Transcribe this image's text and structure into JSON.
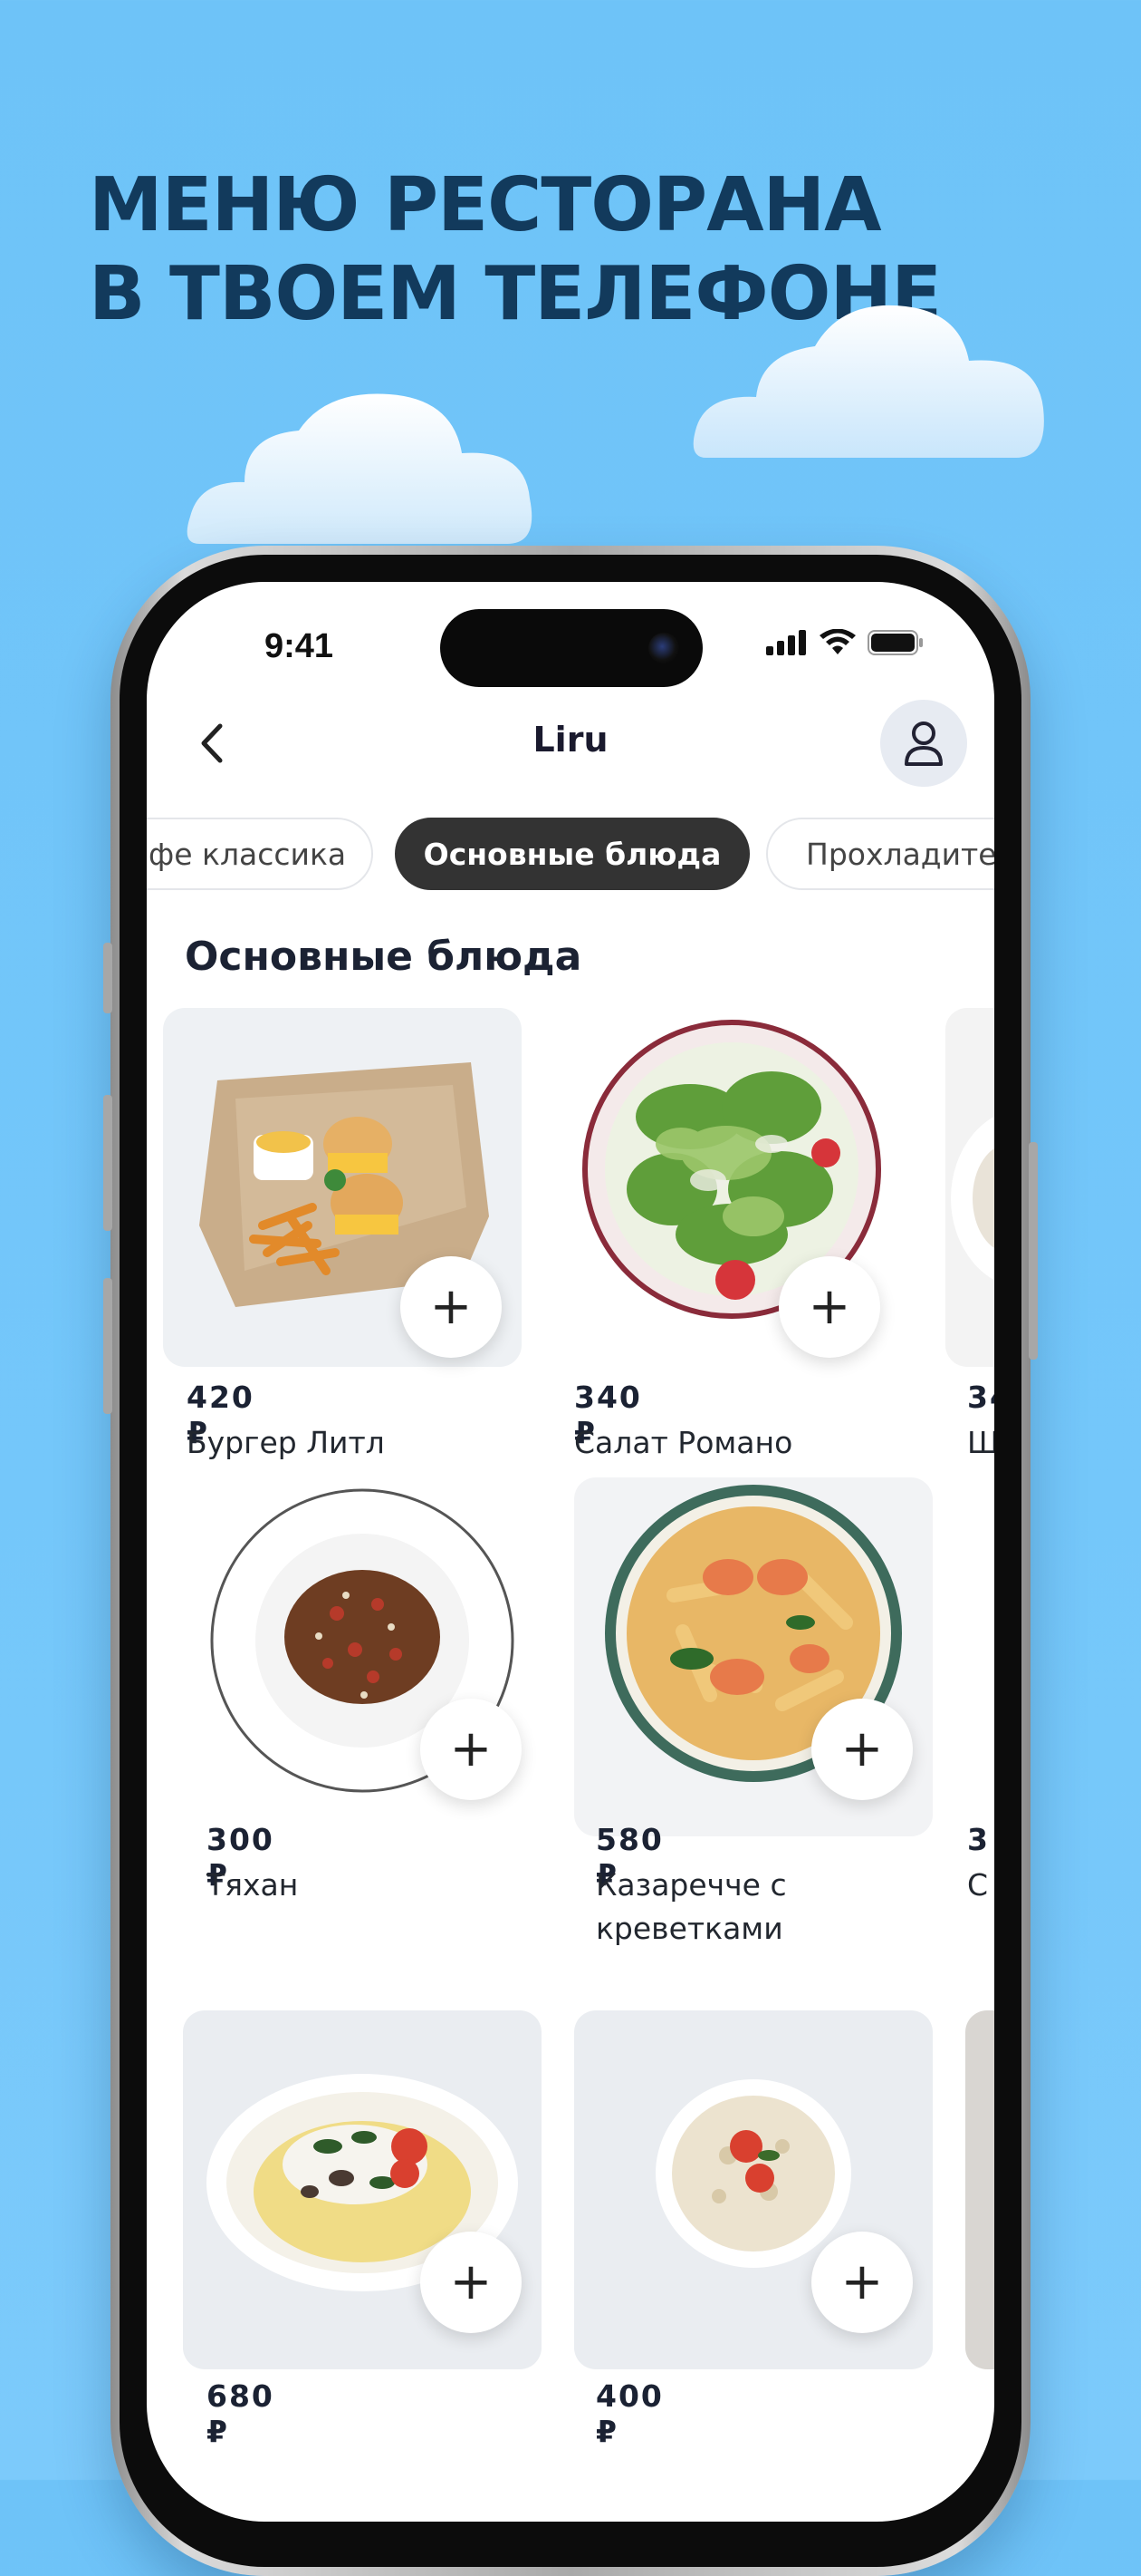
{
  "promo": {
    "headline_line1": "МЕНЮ РЕСТОРАНА",
    "headline_line2": "В ТВОЕМ ТЕЛЕФОНЕ"
  },
  "status_bar": {
    "time": "9:41"
  },
  "nav": {
    "title": "Liru"
  },
  "categories": [
    {
      "label": "фе классика",
      "active": false
    },
    {
      "label": "Основные блюда",
      "active": true
    },
    {
      "label": "Прохладител",
      "active": false
    }
  ],
  "section": {
    "title": "Основные блюда"
  },
  "dishes": [
    {
      "price": "420 ₽",
      "name": "Бургер Литл"
    },
    {
      "price": "340 ₽",
      "name": "Салат Романо"
    },
    {
      "price": "34",
      "name": "Ш"
    },
    {
      "price": "300 ₽",
      "name": "Тяхан"
    },
    {
      "price": "580 ₽",
      "name": "Казаречче с креветками"
    },
    {
      "price": "3",
      "name": "С"
    },
    {
      "price": "680 ₽",
      "name": ""
    },
    {
      "price": "400 ₽",
      "name": ""
    }
  ],
  "add_button_symbol": "+"
}
